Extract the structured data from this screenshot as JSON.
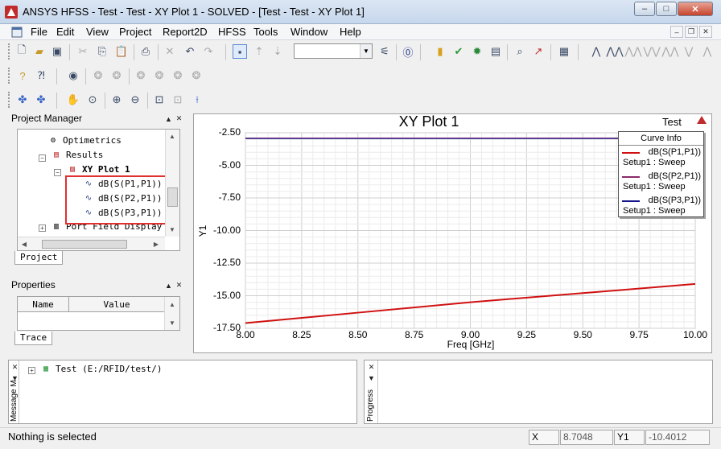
{
  "window": {
    "title": "ANSYS HFSS - Test - Test - XY Plot 1 - SOLVED - [Test - Test - XY Plot 1]",
    "minimize": "–",
    "maximize": "□",
    "close": "✕"
  },
  "menu": {
    "items": [
      "File",
      "Edit",
      "View",
      "Project",
      "Report2D",
      "HFSS",
      "Tools",
      "Window",
      "Help"
    ],
    "mdi_minimize": "–",
    "mdi_restore": "❐",
    "mdi_close": "✕"
  },
  "toolbar": {
    "combo_value": ""
  },
  "project_manager": {
    "title": "Project Manager",
    "tab": "Project",
    "tree": [
      {
        "label": "Optimetrics",
        "icon": "optimetrics-icon"
      },
      {
        "label": "Results",
        "icon": "results-icon"
      },
      {
        "label": "XY Plot 1",
        "icon": "xy-plot-icon"
      },
      {
        "label": "dB(S(P1,P1))",
        "icon": "trace-icon"
      },
      {
        "label": "dB(S(P2,P1))",
        "icon": "trace-icon"
      },
      {
        "label": "dB(S(P3,P1))",
        "icon": "trace-icon"
      },
      {
        "label": "Port Field Display",
        "icon": "port-field-icon"
      }
    ]
  },
  "properties": {
    "title": "Properties",
    "columns": [
      "Name",
      "Value"
    ],
    "tab": "Trace"
  },
  "plot": {
    "title": "XY Plot 1",
    "corner_label": "Test",
    "legend_title": "Curve Info"
  },
  "chart_data": {
    "type": "line",
    "title": "XY Plot 1",
    "xlabel": "Freq [GHz]",
    "ylabel": "Y1",
    "xlim": [
      8.0,
      10.0
    ],
    "ylim": [
      -17.5,
      -2.5
    ],
    "x_ticks": [
      "8.00",
      "8.25",
      "8.50",
      "8.75",
      "9.00",
      "9.25",
      "9.50",
      "9.75",
      "10.00"
    ],
    "y_ticks": [
      "-2.50",
      "-5.00",
      "-7.50",
      "-10.00",
      "-12.50",
      "-15.00",
      "-17.50"
    ],
    "grid": true,
    "legend_position": "top-right",
    "series": [
      {
        "name": "dB(S(P1,P1))",
        "setup": "Setup1 : Sweep",
        "color": "#d01010",
        "x": [
          8.0,
          8.5,
          9.0,
          9.5,
          10.0
        ],
        "values": [
          -17.1,
          -16.3,
          -15.5,
          -14.8,
          -14.1
        ]
      },
      {
        "name": "dB(S(P2,P1))",
        "setup": "Setup1 : Sweep",
        "color": "#8a2a6a",
        "x": [
          8.0,
          8.5,
          9.0,
          9.5,
          10.0
        ],
        "values": [
          -2.9,
          -2.9,
          -2.9,
          -2.9,
          -2.9
        ]
      },
      {
        "name": "dB(S(P3,P1))",
        "setup": "Setup1 : Sweep",
        "color": "#14148c",
        "x": [
          8.0,
          8.5,
          9.0,
          9.5,
          10.0
        ],
        "values": [
          -2.95,
          -2.95,
          -2.95,
          -2.95,
          -2.95
        ]
      }
    ]
  },
  "message_manager": {
    "label": "Message M",
    "tree_item": "Test (E:/RFID/test/)"
  },
  "progress": {
    "label": "Progress"
  },
  "status": {
    "text": "Nothing is selected",
    "x_label": "X",
    "x_value": "8.7048",
    "y_label": "Y1",
    "y_value": "-10.4012"
  },
  "colors": {
    "highlight_box": "#e03030",
    "grid": "#d9d9d9"
  }
}
